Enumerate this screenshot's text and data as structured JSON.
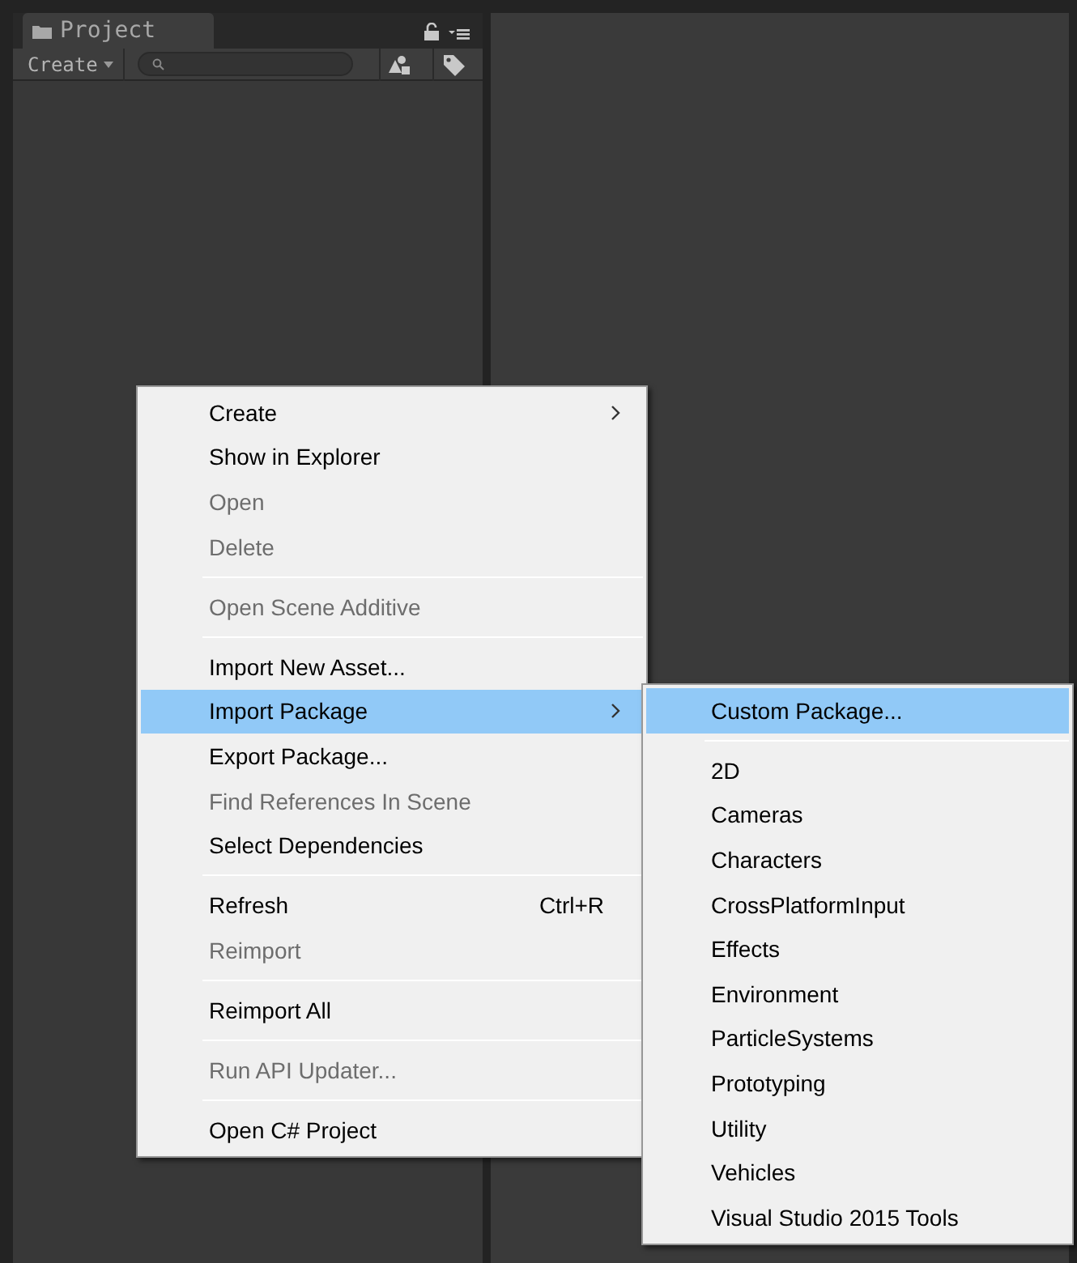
{
  "panel": {
    "tab": "Project",
    "create_button": "Create"
  },
  "context_menu": [
    {
      "kind": "item",
      "label": "Create",
      "disabled": false,
      "selected": false,
      "submenu": true
    },
    {
      "kind": "item",
      "label": "Show in Explorer",
      "disabled": false,
      "selected": false,
      "submenu": false
    },
    {
      "kind": "item",
      "label": "Open",
      "disabled": true,
      "selected": false,
      "submenu": false
    },
    {
      "kind": "item",
      "label": "Delete",
      "disabled": true,
      "selected": false,
      "submenu": false
    },
    {
      "kind": "separator"
    },
    {
      "kind": "item",
      "label": "Open Scene Additive",
      "disabled": true,
      "selected": false,
      "submenu": false
    },
    {
      "kind": "separator"
    },
    {
      "kind": "item",
      "label": "Import New Asset...",
      "disabled": false,
      "selected": false,
      "submenu": false
    },
    {
      "kind": "item",
      "label": "Import Package",
      "disabled": false,
      "selected": true,
      "submenu": true
    },
    {
      "kind": "item",
      "label": "Export Package...",
      "disabled": false,
      "selected": false,
      "submenu": false
    },
    {
      "kind": "item",
      "label": "Find References In Scene",
      "disabled": true,
      "selected": false,
      "submenu": false
    },
    {
      "kind": "item",
      "label": "Select Dependencies",
      "disabled": false,
      "selected": false,
      "submenu": false
    },
    {
      "kind": "separator"
    },
    {
      "kind": "item",
      "label": "Refresh",
      "disabled": false,
      "selected": false,
      "submenu": false,
      "shortcut": "Ctrl+R"
    },
    {
      "kind": "item",
      "label": "Reimport",
      "disabled": true,
      "selected": false,
      "submenu": false
    },
    {
      "kind": "separator"
    },
    {
      "kind": "item",
      "label": "Reimport All",
      "disabled": false,
      "selected": false,
      "submenu": false
    },
    {
      "kind": "separator"
    },
    {
      "kind": "item",
      "label": "Run API Updater...",
      "disabled": true,
      "selected": false,
      "submenu": false
    },
    {
      "kind": "separator"
    },
    {
      "kind": "item",
      "label": "Open C# Project",
      "disabled": false,
      "selected": false,
      "submenu": false
    }
  ],
  "submenu": [
    {
      "kind": "item",
      "label": "Custom Package...",
      "disabled": false,
      "selected": true,
      "submenu": false
    },
    {
      "kind": "separator"
    },
    {
      "kind": "item",
      "label": "2D",
      "disabled": false,
      "selected": false,
      "submenu": false
    },
    {
      "kind": "item",
      "label": "Cameras",
      "disabled": false,
      "selected": false,
      "submenu": false
    },
    {
      "kind": "item",
      "label": "Characters",
      "disabled": false,
      "selected": false,
      "submenu": false
    },
    {
      "kind": "item",
      "label": "CrossPlatformInput",
      "disabled": false,
      "selected": false,
      "submenu": false
    },
    {
      "kind": "item",
      "label": "Effects",
      "disabled": false,
      "selected": false,
      "submenu": false
    },
    {
      "kind": "item",
      "label": "Environment",
      "disabled": false,
      "selected": false,
      "submenu": false
    },
    {
      "kind": "item",
      "label": "ParticleSystems",
      "disabled": false,
      "selected": false,
      "submenu": false
    },
    {
      "kind": "item",
      "label": "Prototyping",
      "disabled": false,
      "selected": false,
      "submenu": false
    },
    {
      "kind": "item",
      "label": "Utility",
      "disabled": false,
      "selected": false,
      "submenu": false
    },
    {
      "kind": "item",
      "label": "Vehicles",
      "disabled": false,
      "selected": false,
      "submenu": false
    },
    {
      "kind": "item",
      "label": "Visual Studio 2015 Tools",
      "disabled": false,
      "selected": false,
      "submenu": false
    }
  ]
}
